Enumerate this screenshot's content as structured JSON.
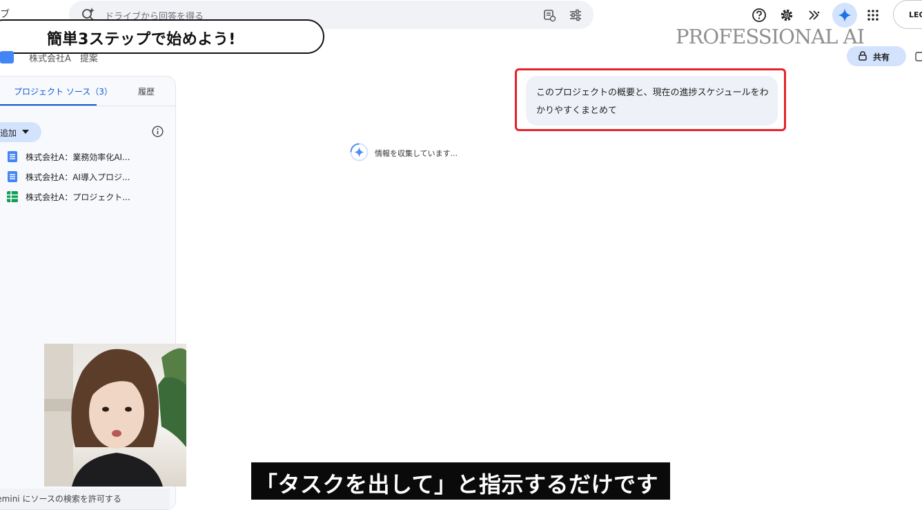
{
  "app": {
    "title_fragment": "ブ"
  },
  "search": {
    "placeholder": "ドライブから回答を得る",
    "icons": [
      "search-spark-icon",
      "filter-history-icon",
      "tune-icon"
    ]
  },
  "header": {
    "icons": [
      "help-icon",
      "gear-icon",
      "expand-icon",
      "gemini-icon",
      "apps-grid-icon"
    ],
    "account_label": "LEO",
    "brand_text": "PROFESSIONAL AI"
  },
  "overlay": {
    "step_banner": "簡単3ステップで始めよう!",
    "caption": "「タスクを出して」と指示するだけです"
  },
  "document": {
    "title": "株式会社A　提案",
    "share_label": "共有"
  },
  "sidebar": {
    "tabs": [
      {
        "label": "プロジェクト ソース（3）",
        "active": true
      },
      {
        "label": "履歴",
        "active": false
      }
    ],
    "add_label": "追加",
    "sources": [
      {
        "type": "doc",
        "label": "株式会社A：業務効率化AI..."
      },
      {
        "type": "doc",
        "label": "株式会社A：AI導入プロジ..."
      },
      {
        "type": "sheet",
        "label": "株式会社A：プロジェクト..."
      }
    ],
    "footer_text": "Gemini にソースの検索を許可する"
  },
  "chat": {
    "user_message": "このプロジェクトの概要と、現在の進捗スケジュールをわかりやすくまとめて",
    "status_text": "情報を収集しています..."
  },
  "colors": {
    "accent": "#0b57d0",
    "chip_bg": "#d3e3fd",
    "highlight": "#e8202a",
    "doc_blue": "#4285f4",
    "sheet_green": "#0f9d58"
  }
}
